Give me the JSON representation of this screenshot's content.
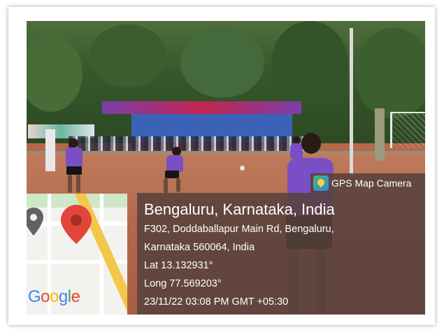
{
  "overlay": {
    "camera_label": "GPS Map Camera",
    "location_title": "Bengaluru, Karnataka, India",
    "address_line1": "F302, Doddaballapur Main Rd, Bengaluru,",
    "address_line2": "Karnataka 560064, India",
    "latitude": "Lat 13.132931°",
    "longitude": "Long 77.569203°",
    "datetime": "23/11/22 03:08 PM GMT +05:30"
  },
  "map": {
    "logo_letters": [
      "G",
      "o",
      "o",
      "g",
      "l",
      "e"
    ],
    "logo_colors": [
      "#4285F4",
      "#EA4335",
      "#FBBC05",
      "#4285F4",
      "#34A853",
      "#EA4335"
    ],
    "pin_color": "#e2453a",
    "route_color": "#f3c84a"
  },
  "photo": {
    "jersey_color": "#7a4fc4",
    "ground_color": "#b5694a"
  }
}
